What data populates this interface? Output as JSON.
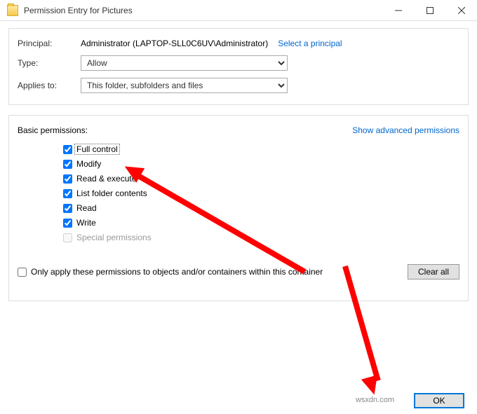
{
  "titlebar": {
    "title": "Permission Entry for Pictures"
  },
  "principal": {
    "label": "Principal:",
    "value": "Administrator (LAPTOP-SLL0C6UV\\Administrator)",
    "select_link": "Select a principal"
  },
  "type": {
    "label": "Type:",
    "value": "Allow"
  },
  "applies": {
    "label": "Applies to:",
    "value": "This folder, subfolders and files"
  },
  "perms": {
    "heading": "Basic permissions:",
    "advanced_link": "Show advanced permissions",
    "items": {
      "full": "Full control",
      "modify": "Modify",
      "readexec": "Read & execute",
      "list": "List folder contents",
      "read": "Read",
      "write": "Write",
      "special": "Special permissions"
    },
    "only_apply": "Only apply these permissions to objects and/or containers within this container",
    "clear_all": "Clear all"
  },
  "buttons": {
    "ok": "OK"
  },
  "watermark": "wsxdn.com"
}
